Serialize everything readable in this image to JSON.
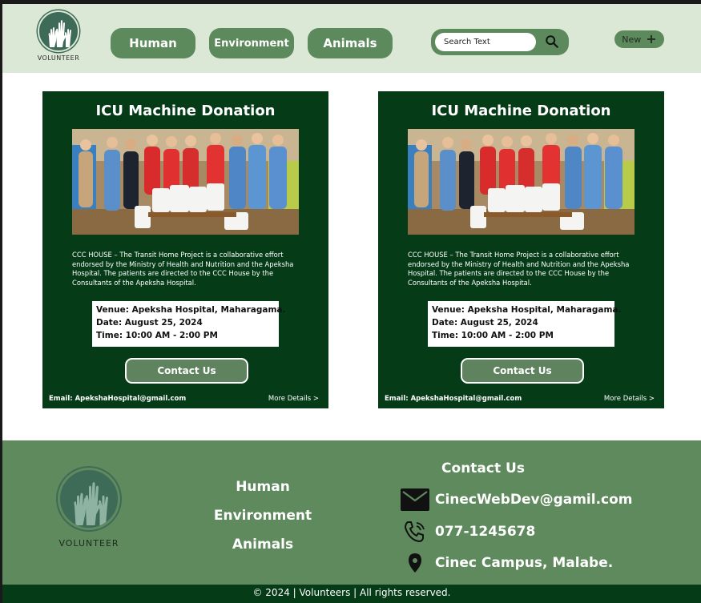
{
  "header": {
    "logo_text": "VOLUNTEER",
    "nav": [
      "Human",
      "Environment",
      "Animals"
    ],
    "search_placeholder": "Search Text",
    "new_label": "New"
  },
  "cards": [
    {
      "title": "ICU Machine Donation",
      "description": "CCC HOUSE – The Transit Home Project is a collaborative effort endorsed by the Ministry of Health and Nutrition and the Apeksha Hospital. The patients are directed to the CCC House by the Consultants of the Apeksha Hospital.",
      "venue": "Venue: Apeksha Hospital, Maharagama.",
      "date": "Date: August 25, 2024",
      "time": "Time: 10:00 AM - 2:00 PM",
      "contact_label": "Contact Us",
      "email": "Email: ApekshaHospital@gmail.com",
      "more_label": "More Details >"
    },
    {
      "title": "ICU Machine Donation",
      "description": "CCC HOUSE – The Transit Home Project is a collaborative effort endorsed by the Ministry of Health and Nutrition and the Apeksha Hospital. The patients are directed to the CCC House by the Consultants of the Apeksha Hospital.",
      "venue": "Venue: Apeksha Hospital, Maharagama.",
      "date": "Date: August 25, 2024",
      "time": "Time: 10:00 AM - 2:00 PM",
      "contact_label": "Contact Us",
      "email": "Email: ApekshaHospital@gmail.com",
      "more_label": "More Details >"
    }
  ],
  "footer": {
    "logo_text": "VOLUNTEER",
    "links": [
      "Human",
      "Environment",
      "Animals"
    ],
    "contact_heading": "Contact Us",
    "email": "CinecWebDev@gamil.com",
    "phone": "077-1245678",
    "location": "Cinec Campus, Malabe.",
    "copyright": "© 2024 | Volunteers | All rights reserved."
  },
  "colors": {
    "header_bg": "#dce8d6",
    "accent_green": "#5c8a5c",
    "card_bg": "#063b18",
    "footer_bg": "#5f8a5d",
    "logo_green": "#3e6b58"
  }
}
